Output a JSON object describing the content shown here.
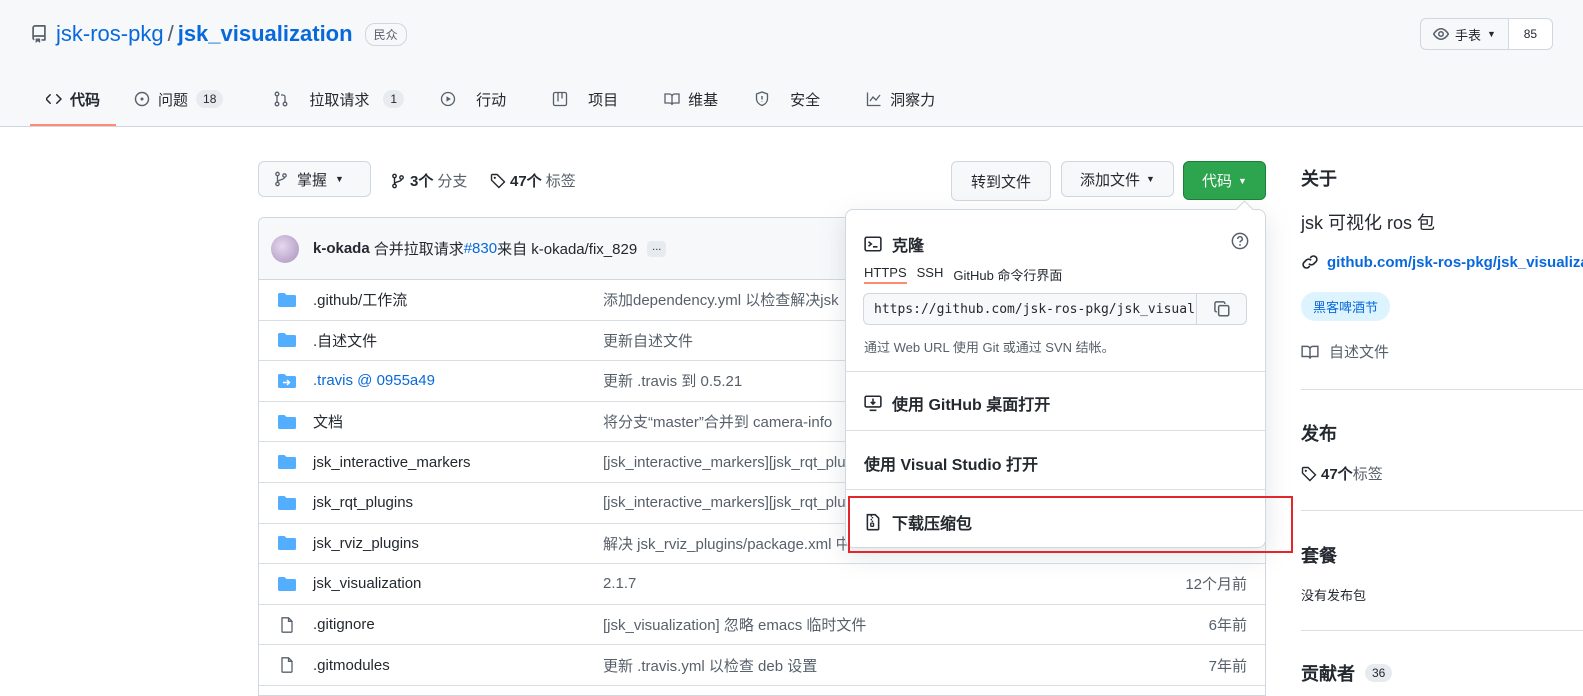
{
  "repo": {
    "owner": "jsk-ros-pkg",
    "separator": "/",
    "name": "jsk_visualization",
    "visibility": "民众"
  },
  "watch": {
    "label": "手表",
    "count": "85"
  },
  "nav": {
    "tabs": [
      {
        "label": "代码",
        "count": ""
      },
      {
        "label": "问题",
        "count": "18"
      },
      {
        "label": "拉取请求",
        "count": "1"
      },
      {
        "label": "行动",
        "count": ""
      },
      {
        "label": "项目",
        "count": ""
      },
      {
        "label": "维基",
        "count": ""
      },
      {
        "label": "安全",
        "count": ""
      },
      {
        "label": "洞察力",
        "count": ""
      }
    ]
  },
  "branch": {
    "current": "掌握",
    "branch_count": "3个",
    "branch_label": "分支",
    "tag_count": "47个",
    "tag_label": "标签"
  },
  "actions": {
    "goto_file": "转到文件",
    "add_file": "添加文件",
    "code": "代码"
  },
  "commit": {
    "user": "k-okada",
    "msg_prefix": "合并拉取请求",
    "pr": "#830",
    "msg_suffix": "来自 k-okada/fix_829",
    "more": "..."
  },
  "files": [
    {
      "type": "dir",
      "name": ".github/工作流",
      "msg": "添加dependency.yml 以检查解决jsk",
      "time": ""
    },
    {
      "type": "dir",
      "name": ".自述文件",
      "msg": "更新自述文件",
      "time": ""
    },
    {
      "type": "submodule",
      "name": ".travis @ 0955a49",
      "msg": "更新 .travis 到 0.5.21",
      "time": ""
    },
    {
      "type": "dir",
      "name": "文档",
      "msg": "将分支“master”合并到 camera-info",
      "time": ""
    },
    {
      "type": "dir",
      "name": "jsk_interactive_markers",
      "msg": "[jsk_interactive_markers][jsk_rqt_plu",
      "time": ""
    },
    {
      "type": "dir",
      "name": "jsk_rqt_plugins",
      "msg": "[jsk_interactive_markers][jsk_rqt_plu",
      "time": ""
    },
    {
      "type": "dir",
      "name": "jsk_rviz_plugins",
      "msg": "解决 jsk_rviz_plugins/package.xml 中",
      "time": ""
    },
    {
      "type": "dir",
      "name": "jsk_visualization",
      "msg": "2.1.7",
      "time": "12个月前"
    },
    {
      "type": "file",
      "name": ".gitignore",
      "msg": "[jsk_visualization] 忽略 emacs 临时文件",
      "time": "6年前"
    },
    {
      "type": "file",
      "name": ".gitmodules",
      "msg": "更新 .travis.yml 以检查 deb 设置",
      "time": "7年前"
    }
  ],
  "dropdown": {
    "clone_title": "克隆",
    "tabs": [
      "HTTPS",
      "SSH",
      "GitHub 命令行界面"
    ],
    "url": "https://github.com/jsk-ros-pkg/jsk_visual:",
    "note": "通过 Web URL 使用 Git 或通过 SVN 结帐。",
    "open_desktop": "使用 GitHub 桌面打开",
    "open_vs": "使用 Visual Studio 打开",
    "download_zip": "下载压缩包"
  },
  "sidebar": {
    "about_title": "关于",
    "description": "jsk 可视化 ros 包",
    "link": "github.com/jsk-ros-pkg/jsk_visualization",
    "topic": "黑客啤酒节",
    "readme": "自述文件",
    "releases_title": "发布",
    "tags_count": "47个",
    "tags_label": "标签",
    "packages_title": "套餐",
    "packages_none": "没有发布包",
    "contributors_title": "贡献者",
    "contributors_count": "36"
  }
}
